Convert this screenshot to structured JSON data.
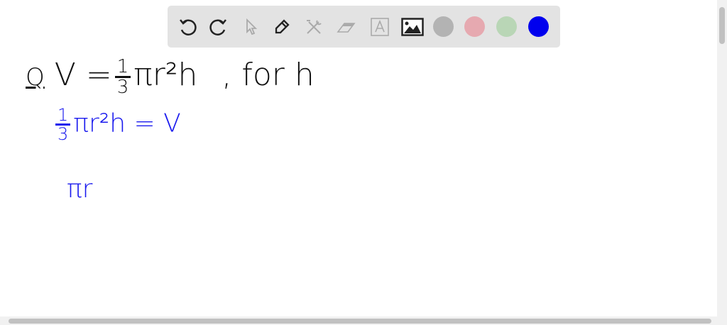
{
  "toolbar": {
    "tools": [
      "undo-icon",
      "redo-icon",
      "select-icon",
      "pen-icon",
      "tools-icon",
      "eraser-icon",
      "text-icon",
      "image-icon"
    ],
    "colors": [
      "#b3b3b3",
      "#e6a9b0",
      "#b9d6b6",
      "#0000ee"
    ]
  },
  "canvas": {
    "line1": {
      "label": "Q",
      "lhs": "V",
      "eq": "=",
      "num": "1",
      "den": "3",
      "rest": "πr²h",
      "tail": ", for  h"
    },
    "line2": {
      "num": "1",
      "den": "3",
      "rest": "πr²h",
      "eq": "=",
      "rhs": "V"
    },
    "line3": {
      "text": "πr"
    },
    "ink_black": "#111111",
    "ink_blue": "#1a1aee"
  }
}
